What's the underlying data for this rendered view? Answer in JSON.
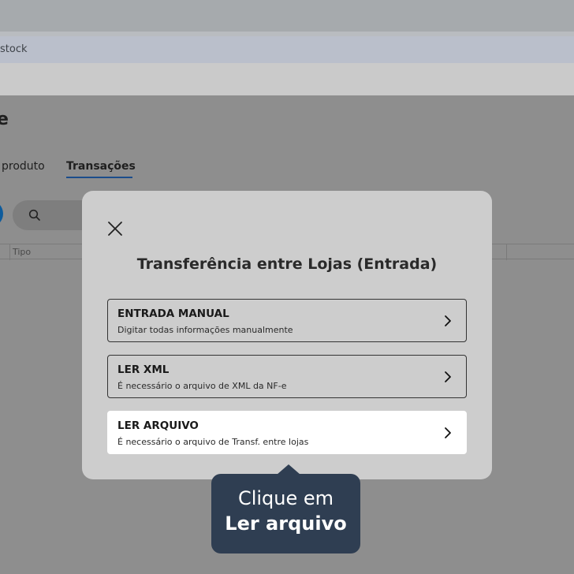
{
  "browser": {
    "url_fragment": "stock"
  },
  "page": {
    "title_fragment": "e",
    "tabs": [
      {
        "label": "produto"
      },
      {
        "label": "Transações"
      }
    ],
    "table": {
      "columns": [
        "Tipo"
      ]
    }
  },
  "modal": {
    "title": "Transferência entre Lojas (Entrada)",
    "options": [
      {
        "title": "ENTRADA MANUAL",
        "subtitle": "Digitar todas informações manualmente"
      },
      {
        "title": "LER XML",
        "subtitle": "É necessário o arquivo de XML da NF-e"
      },
      {
        "title": "LER ARQUIVO",
        "subtitle": "É necessário o arquivo de Transf. entre lojas"
      }
    ]
  },
  "tooltip": {
    "line1": "Clique em",
    "line2": "Ler arquivo"
  },
  "colors": {
    "accent": "#1b4d8b",
    "tooltip_bg": "#2f3e52",
    "modal_bg": "#cdcdcd",
    "overlay": "#8e8e8e"
  },
  "icons": [
    "search-icon",
    "close-icon",
    "chevron-right-icon"
  ]
}
